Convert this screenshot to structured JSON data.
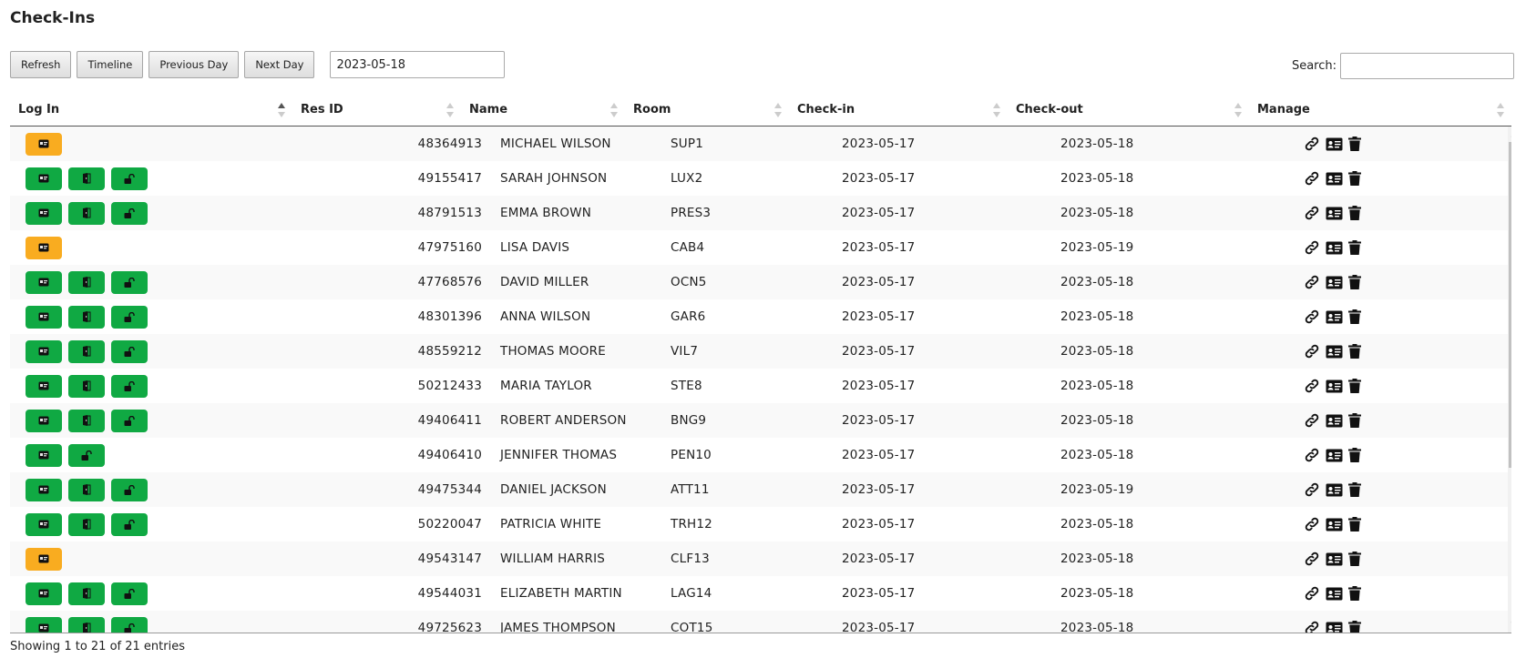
{
  "page": {
    "title": "Check-Ins"
  },
  "toolbar": {
    "refresh_label": "Refresh",
    "timeline_label": "Timeline",
    "previous_day_label": "Previous Day",
    "next_day_label": "Next Day",
    "date_value": "2023-05-18"
  },
  "search": {
    "label": "Search:",
    "value": ""
  },
  "table": {
    "columns": [
      "Log In",
      "Res ID",
      "Name",
      "Room",
      "Check-in",
      "Check-out",
      "Manage"
    ],
    "sorted_column": "Log In",
    "sort_direction": "ascending",
    "rows": [
      {
        "res_id": "48364913",
        "name": "MICHAEL WILSON",
        "room": "SUP1",
        "checkin": "2023-05-17",
        "checkout": "2023-05-18",
        "login_buttons": [
          "card"
        ],
        "status": "pending"
      },
      {
        "res_id": "49155417",
        "name": "SARAH JOHNSON",
        "room": "LUX2",
        "checkin": "2023-05-17",
        "checkout": "2023-05-18",
        "login_buttons": [
          "card",
          "door",
          "unlock"
        ],
        "status": "active"
      },
      {
        "res_id": "48791513",
        "name": "EMMA BROWN",
        "room": "PRES3",
        "checkin": "2023-05-17",
        "checkout": "2023-05-18",
        "login_buttons": [
          "card",
          "door",
          "unlock"
        ],
        "status": "active"
      },
      {
        "res_id": "47975160",
        "name": "LISA DAVIS",
        "room": "CAB4",
        "checkin": "2023-05-17",
        "checkout": "2023-05-19",
        "login_buttons": [
          "card"
        ],
        "status": "pending"
      },
      {
        "res_id": "47768576",
        "name": "DAVID MILLER",
        "room": "OCN5",
        "checkin": "2023-05-17",
        "checkout": "2023-05-18",
        "login_buttons": [
          "card",
          "door",
          "unlock"
        ],
        "status": "active"
      },
      {
        "res_id": "48301396",
        "name": "ANNA WILSON",
        "room": "GAR6",
        "checkin": "2023-05-17",
        "checkout": "2023-05-18",
        "login_buttons": [
          "card",
          "door",
          "unlock"
        ],
        "status": "active"
      },
      {
        "res_id": "48559212",
        "name": "THOMAS MOORE",
        "room": "VIL7",
        "checkin": "2023-05-17",
        "checkout": "2023-05-18",
        "login_buttons": [
          "card",
          "door",
          "unlock"
        ],
        "status": "active"
      },
      {
        "res_id": "50212433",
        "name": "MARIA TAYLOR",
        "room": "STE8",
        "checkin": "2023-05-17",
        "checkout": "2023-05-18",
        "login_buttons": [
          "card",
          "door",
          "unlock"
        ],
        "status": "active"
      },
      {
        "res_id": "49406411",
        "name": "ROBERT ANDERSON",
        "room": "BNG9",
        "checkin": "2023-05-17",
        "checkout": "2023-05-18",
        "login_buttons": [
          "card",
          "door",
          "unlock"
        ],
        "status": "active"
      },
      {
        "res_id": "49406410",
        "name": "JENNIFER THOMAS",
        "room": "PEN10",
        "checkin": "2023-05-17",
        "checkout": "2023-05-18",
        "login_buttons": [
          "card",
          "unlock"
        ],
        "status": "active"
      },
      {
        "res_id": "49475344",
        "name": "DANIEL JACKSON",
        "room": "ATT11",
        "checkin": "2023-05-17",
        "checkout": "2023-05-19",
        "login_buttons": [
          "card",
          "door",
          "unlock"
        ],
        "status": "active"
      },
      {
        "res_id": "50220047",
        "name": "PATRICIA WHITE",
        "room": "TRH12",
        "checkin": "2023-05-17",
        "checkout": "2023-05-18",
        "login_buttons": [
          "card",
          "door",
          "unlock"
        ],
        "status": "active"
      },
      {
        "res_id": "49543147",
        "name": "WILLIAM HARRIS",
        "room": "CLF13",
        "checkin": "2023-05-17",
        "checkout": "2023-05-18",
        "login_buttons": [
          "card"
        ],
        "status": "pending"
      },
      {
        "res_id": "49544031",
        "name": "ELIZABETH MARTIN",
        "room": "LAG14",
        "checkin": "2023-05-17",
        "checkout": "2023-05-18",
        "login_buttons": [
          "card",
          "door",
          "unlock"
        ],
        "status": "active"
      },
      {
        "res_id": "49725623",
        "name": "JAMES THOMPSON",
        "room": "COT15",
        "checkin": "2023-05-17",
        "checkout": "2023-05-18",
        "login_buttons": [
          "card",
          "door",
          "unlock"
        ],
        "status": "active"
      }
    ]
  },
  "manage_icons": [
    "link-icon",
    "id-card-icon",
    "trash-icon"
  ],
  "footer": {
    "info": "Showing 1 to 21 of 21 entries"
  },
  "colors": {
    "active": "#10a943",
    "pending": "#f9ac20"
  }
}
